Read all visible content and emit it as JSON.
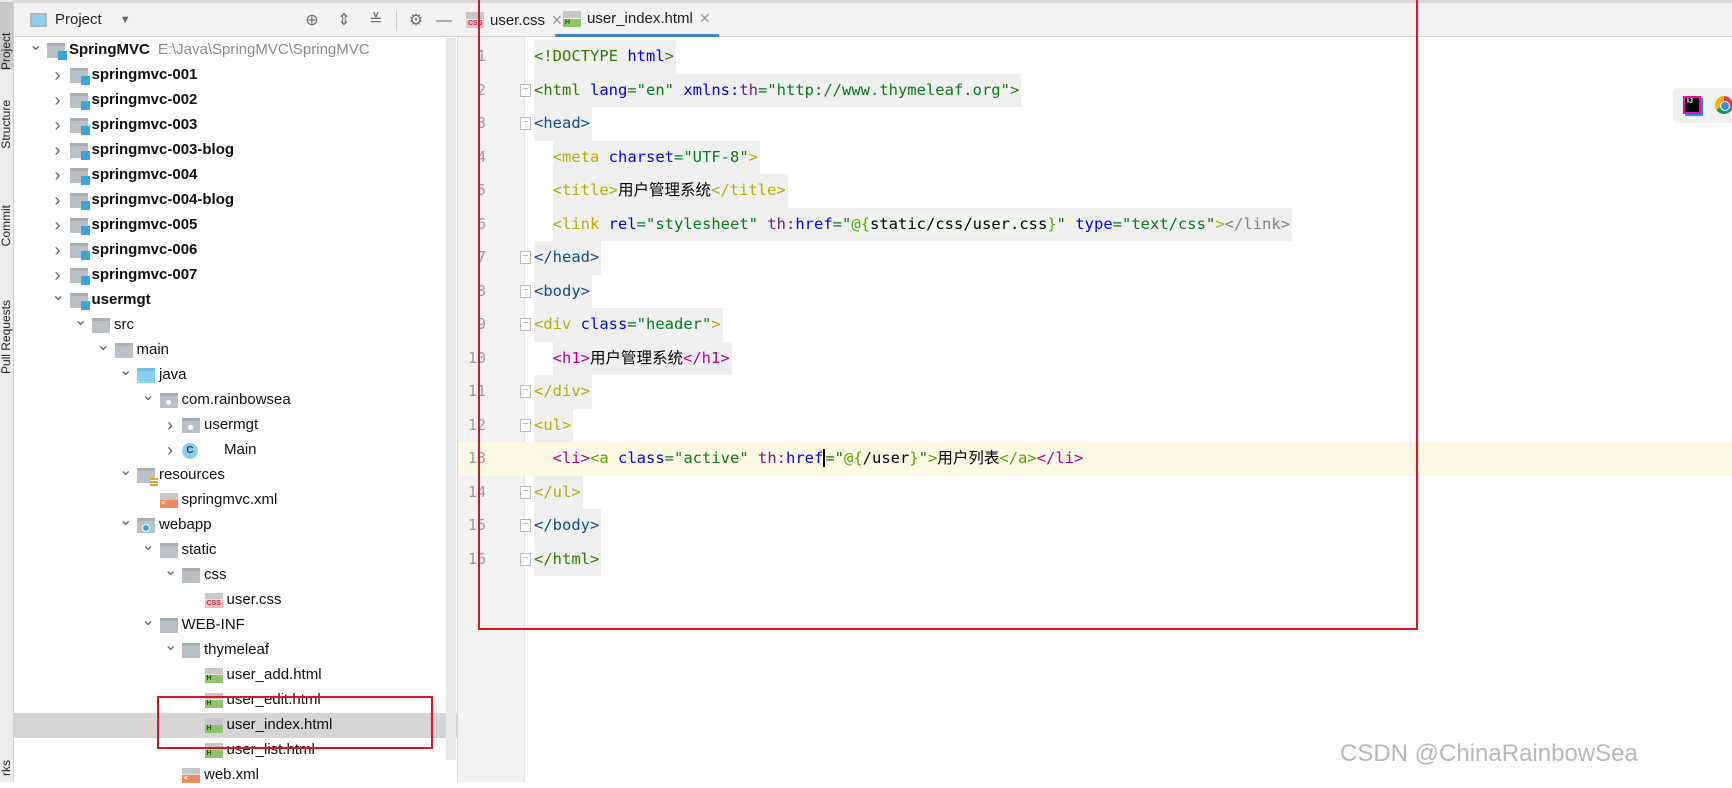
{
  "side_strip": {
    "tabs": [
      "Project",
      "Structure",
      "Commit",
      "Pull Requests",
      "rks"
    ]
  },
  "project_panel": {
    "title": "Project",
    "toolbar": [
      "locate-icon",
      "expand-all-icon",
      "collapse-all-icon",
      "gear-icon",
      "minimize-icon"
    ],
    "tree": [
      {
        "label": "SpringMVC",
        "hint": "E:\\Java\\SpringMVC\\SpringMVC",
        "depth": 0,
        "state": "open",
        "icon": "module",
        "bold": true
      },
      {
        "label": "springmvc-001",
        "depth": 1,
        "state": "closed",
        "icon": "module",
        "bold": true
      },
      {
        "label": "springmvc-002",
        "depth": 1,
        "state": "closed",
        "icon": "module",
        "bold": true
      },
      {
        "label": "springmvc-003",
        "depth": 1,
        "state": "closed",
        "icon": "module",
        "bold": true
      },
      {
        "label": "springmvc-003-blog",
        "depth": 1,
        "state": "closed",
        "icon": "module",
        "bold": true
      },
      {
        "label": "springmvc-004",
        "depth": 1,
        "state": "closed",
        "icon": "module",
        "bold": true
      },
      {
        "label": "springmvc-004-blog",
        "depth": 1,
        "state": "closed",
        "icon": "module",
        "bold": true
      },
      {
        "label": "springmvc-005",
        "depth": 1,
        "state": "closed",
        "icon": "module",
        "bold": true
      },
      {
        "label": "springmvc-006",
        "depth": 1,
        "state": "closed",
        "icon": "module",
        "bold": true
      },
      {
        "label": "springmvc-007",
        "depth": 1,
        "state": "closed",
        "icon": "module",
        "bold": true
      },
      {
        "label": "usermgt",
        "depth": 1,
        "state": "open",
        "icon": "module",
        "bold": true
      },
      {
        "label": "src",
        "depth": 2,
        "state": "open",
        "icon": "folder"
      },
      {
        "label": "main",
        "depth": 3,
        "state": "open",
        "icon": "folder"
      },
      {
        "label": "java",
        "depth": 4,
        "state": "open",
        "icon": "source-folder"
      },
      {
        "label": "com.rainbowsea",
        "depth": 5,
        "state": "open",
        "icon": "package"
      },
      {
        "label": "usermgt",
        "depth": 6,
        "state": "closed",
        "icon": "package"
      },
      {
        "label": "Main",
        "depth": 6,
        "state": "closed",
        "icon": "class"
      },
      {
        "label": "resources",
        "depth": 4,
        "state": "open",
        "icon": "resources-folder"
      },
      {
        "label": "springmvc.xml",
        "depth": 5,
        "state": "leaf",
        "icon": "xml"
      },
      {
        "label": "webapp",
        "depth": 4,
        "state": "open",
        "icon": "web-folder"
      },
      {
        "label": "static",
        "depth": 5,
        "state": "open",
        "icon": "folder"
      },
      {
        "label": "css",
        "depth": 6,
        "state": "open",
        "icon": "folder"
      },
      {
        "label": "user.css",
        "depth": 7,
        "state": "leaf",
        "icon": "css"
      },
      {
        "label": "WEB-INF",
        "depth": 5,
        "state": "open",
        "icon": "folder"
      },
      {
        "label": "thymeleaf",
        "depth": 6,
        "state": "open",
        "icon": "folder"
      },
      {
        "label": "user_add.html",
        "depth": 7,
        "state": "leaf",
        "icon": "html"
      },
      {
        "label": "user_edit.html",
        "depth": 7,
        "state": "leaf",
        "icon": "html"
      },
      {
        "label": "user_index.html",
        "depth": 7,
        "state": "leaf",
        "icon": "html",
        "selected": true
      },
      {
        "label": "user_list.html",
        "depth": 7,
        "state": "leaf",
        "icon": "html"
      },
      {
        "label": "web.xml",
        "depth": 6,
        "state": "leaf",
        "icon": "xml"
      }
    ]
  },
  "editor": {
    "tabs": [
      {
        "label": "user.css",
        "icon": "css",
        "active": false
      },
      {
        "label": "user_index.html",
        "icon": "html",
        "active": true
      }
    ],
    "current_line": 13,
    "folds": [
      2,
      3,
      7,
      8,
      9,
      11,
      12,
      14,
      15,
      16
    ],
    "lines": [
      [
        {
          "t": "<!DOCTYPE ",
          "c": "tgr"
        },
        {
          "t": "html",
          "c": "at"
        },
        {
          "t": ">",
          "c": "tgr"
        }
      ],
      [
        {
          "t": "<html ",
          "c": "tgr"
        },
        {
          "t": "lang",
          "c": "at"
        },
        {
          "t": "=\"en\" ",
          "c": "av"
        },
        {
          "t": "xmlns:",
          "c": "at"
        },
        {
          "t": "th",
          "c": "ns"
        },
        {
          "t": "=\"http://www.thymeleaf.org\"",
          "c": "av"
        },
        {
          "t": ">",
          "c": "tgr"
        }
      ],
      [
        {
          "t": "<head>",
          "c": "tg"
        }
      ],
      [
        {
          "t": "  "
        },
        {
          "t": "<meta ",
          "c": "ty"
        },
        {
          "t": "charset",
          "c": "at"
        },
        {
          "t": "=\"UTF-8\"",
          "c": "av"
        },
        {
          "t": ">",
          "c": "ty"
        }
      ],
      [
        {
          "t": "  "
        },
        {
          "t": "<title>",
          "c": "ty"
        },
        {
          "t": "用户管理系统",
          "c": "pl cjk"
        },
        {
          "t": "</title>",
          "c": "ty"
        }
      ],
      [
        {
          "t": "  "
        },
        {
          "t": "<link ",
          "c": "ty"
        },
        {
          "t": "rel",
          "c": "at"
        },
        {
          "t": "=\"stylesheet\" ",
          "c": "av"
        },
        {
          "t": "th:",
          "c": "ns"
        },
        {
          "t": "href",
          "c": "at"
        },
        {
          "t": "=\"",
          "c": "av"
        },
        {
          "t": "@{",
          "c": "ta expr"
        },
        {
          "t": "static/css/user.css",
          "c": "pl expr"
        },
        {
          "t": "}",
          "c": "ta expr"
        },
        {
          "t": "\" ",
          "c": "av"
        },
        {
          "t": "type",
          "c": "at"
        },
        {
          "t": "=\"text/css\"",
          "c": "av"
        },
        {
          "t": ">",
          "c": "ty"
        },
        {
          "t": "</link>",
          "c": "gy"
        }
      ],
      [
        {
          "t": "</head>",
          "c": "tg"
        }
      ],
      [
        {
          "t": "<body>",
          "c": "tg"
        }
      ],
      [
        {
          "t": "<div ",
          "c": "ty"
        },
        {
          "t": "class",
          "c": "at"
        },
        {
          "t": "=\"header\"",
          "c": "av"
        },
        {
          "t": ">",
          "c": "ty"
        }
      ],
      [
        {
          "t": "  "
        },
        {
          "t": "<h1>",
          "c": "tm"
        },
        {
          "t": "用户管理系统",
          "c": "pl cjk"
        },
        {
          "t": "</h1>",
          "c": "tm"
        }
      ],
      [
        {
          "t": "</div>",
          "c": "ty"
        }
      ],
      [
        {
          "t": "<ul>",
          "c": "ty"
        }
      ],
      [
        {
          "t": "  "
        },
        {
          "t": "<li>",
          "c": "tm"
        },
        {
          "t": "<a ",
          "c": "ta"
        },
        {
          "t": "class",
          "c": "at"
        },
        {
          "t": "=\"active\" ",
          "c": "av"
        },
        {
          "t": "th:",
          "c": "ns"
        },
        {
          "t": "href",
          "c": "at caret-after"
        },
        {
          "t": "=\"",
          "c": "av"
        },
        {
          "t": "@{",
          "c": "ta"
        },
        {
          "t": "/user",
          "c": "pl"
        },
        {
          "t": "}",
          "c": "ta"
        },
        {
          "t": "\"",
          "c": "av"
        },
        {
          "t": ">",
          "c": "ta"
        },
        {
          "t": "用户列表",
          "c": "pl cjk"
        },
        {
          "t": "</a>",
          "c": "ta"
        },
        {
          "t": "</li>",
          "c": "tm"
        }
      ],
      [
        {
          "t": "</ul>",
          "c": "ty"
        }
      ],
      [
        {
          "t": "</body>",
          "c": "tg"
        }
      ],
      [
        {
          "t": "</html>",
          "c": "tgr"
        }
      ]
    ]
  },
  "floating_toolbar": [
    "intellij-icon",
    "chrome-icon"
  ],
  "watermark": "CSDN @ChinaRainbowSea",
  "colors": {
    "highlight_box": "#e0141e",
    "selection": "#d5d5d5",
    "current_line": "#fdf9e5",
    "active_tab": "#4083c9"
  }
}
